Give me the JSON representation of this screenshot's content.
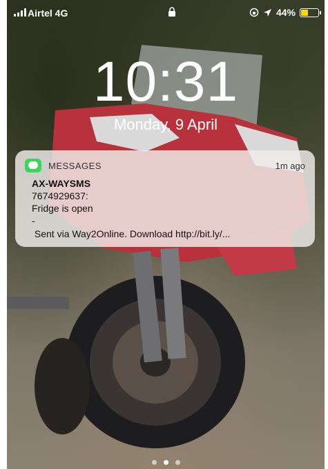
{
  "status_bar": {
    "carrier": "Airtel  4G",
    "battery_percent": "44%",
    "battery_level": 0.44,
    "battery_color": "#ffd60a"
  },
  "lock_screen": {
    "time": "10:31",
    "date": "Monday, 9 April"
  },
  "notification": {
    "app_name": "MESSAGES",
    "time_ago": "1m ago",
    "app_icon": "messages-icon",
    "sender": "AX-WAYSMS",
    "lines": [
      "7674929637:",
      "Fridge is open",
      "-",
      " Sent via Way2Online. Download http://bit.ly/..."
    ],
    "accent": "#3ed35c"
  },
  "page_indicator": {
    "pages": 3,
    "active_page": 2
  }
}
